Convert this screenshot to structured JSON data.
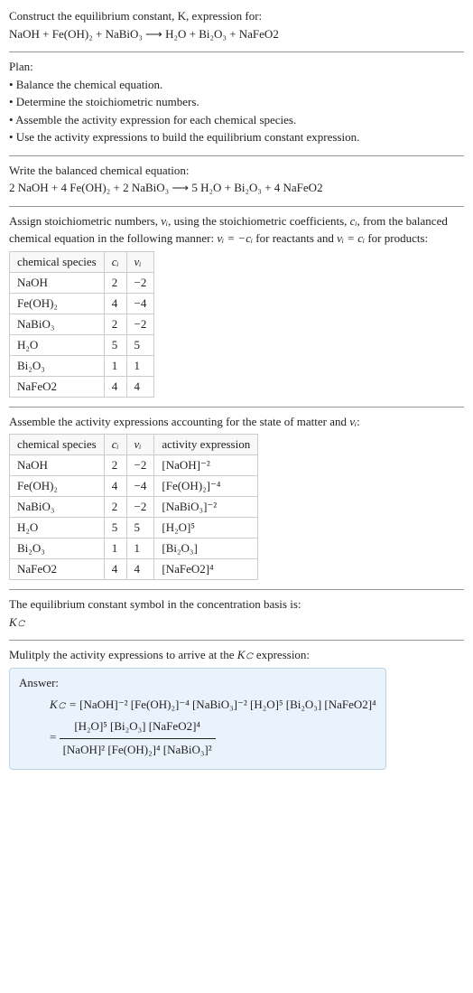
{
  "intro": {
    "title": "Construct the equilibrium constant, K, expression for:",
    "equation": "NaOH + Fe(OH)₂ + NaBiO₃ ⟶ H₂O + Bi₂O₃ + NaFeO2"
  },
  "plan": {
    "heading": "Plan:",
    "items": [
      "• Balance the chemical equation.",
      "• Determine the stoichiometric numbers.",
      "• Assemble the activity expression for each chemical species.",
      "• Use the activity expressions to build the equilibrium constant expression."
    ]
  },
  "balanced": {
    "heading": "Write the balanced chemical equation:",
    "equation": "2 NaOH + 4 Fe(OH)₂ + 2 NaBiO₃ ⟶ 5 H₂O + Bi₂O₃ + 4 NaFeO2"
  },
  "stoich": {
    "intro_a": "Assign stoichiometric numbers, ",
    "nu": "νᵢ",
    "intro_b": ", using the stoichiometric coefficients, ",
    "ci": "cᵢ",
    "intro_c": ", from the balanced chemical equation in the following manner: ",
    "rule_r": "νᵢ = −cᵢ",
    "intro_d": " for reactants and ",
    "rule_p": "νᵢ = cᵢ",
    "intro_e": " for products:",
    "headers": [
      "chemical species",
      "cᵢ",
      "νᵢ"
    ],
    "rows": [
      [
        "NaOH",
        "2",
        "−2"
      ],
      [
        "Fe(OH)₂",
        "4",
        "−4"
      ],
      [
        "NaBiO₃",
        "2",
        "−2"
      ],
      [
        "H₂O",
        "5",
        "5"
      ],
      [
        "Bi₂O₃",
        "1",
        "1"
      ],
      [
        "NaFeO2",
        "4",
        "4"
      ]
    ]
  },
  "activity": {
    "intro_a": "Assemble the activity expressions accounting for the state of matter and ",
    "nu": "νᵢ",
    "intro_b": ":",
    "headers": [
      "chemical species",
      "cᵢ",
      "νᵢ",
      "activity expression"
    ],
    "rows": [
      [
        "NaOH",
        "2",
        "−2",
        "[NaOH]⁻²"
      ],
      [
        "Fe(OH)₂",
        "4",
        "−4",
        "[Fe(OH)₂]⁻⁴"
      ],
      [
        "NaBiO₃",
        "2",
        "−2",
        "[NaBiO₃]⁻²"
      ],
      [
        "H₂O",
        "5",
        "5",
        "[H₂O]⁵"
      ],
      [
        "Bi₂O₃",
        "1",
        "1",
        "[Bi₂O₃]"
      ],
      [
        "NaFeO2",
        "4",
        "4",
        "[NaFeO2]⁴"
      ]
    ]
  },
  "kc_symbol": {
    "text": "The equilibrium constant symbol in the concentration basis is:",
    "symbol": "K𝚌"
  },
  "final": {
    "intro_a": "Mulitply the activity expressions to arrive at the ",
    "kc": "K𝚌",
    "intro_b": " expression:",
    "answer_label": "Answer:",
    "lhs": "K𝚌 = ",
    "flat": "[NaOH]⁻² [Fe(OH)₂]⁻⁴ [NaBiO₃]⁻² [H₂O]⁵ [Bi₂O₃] [NaFeO2]⁴",
    "eq": "  = ",
    "num": "[H₂O]⁵ [Bi₂O₃] [NaFeO2]⁴",
    "den": "[NaOH]² [Fe(OH)₂]⁴ [NaBiO₃]²"
  },
  "chart_data": {
    "type": "table",
    "tables": [
      {
        "title": "stoichiometric numbers",
        "headers": [
          "chemical species",
          "c_i",
          "nu_i"
        ],
        "rows": [
          [
            "NaOH",
            2,
            -2
          ],
          [
            "Fe(OH)2",
            4,
            -4
          ],
          [
            "NaBiO3",
            2,
            -2
          ],
          [
            "H2O",
            5,
            5
          ],
          [
            "Bi2O3",
            1,
            1
          ],
          [
            "NaFeO2",
            4,
            4
          ]
        ]
      },
      {
        "title": "activity expressions",
        "headers": [
          "chemical species",
          "c_i",
          "nu_i",
          "activity expression"
        ],
        "rows": [
          [
            "NaOH",
            2,
            -2,
            "[NaOH]^-2"
          ],
          [
            "Fe(OH)2",
            4,
            -4,
            "[Fe(OH)2]^-4"
          ],
          [
            "NaBiO3",
            2,
            -2,
            "[NaBiO3]^-2"
          ],
          [
            "H2O",
            5,
            5,
            "[H2O]^5"
          ],
          [
            "Bi2O3",
            1,
            1,
            "[Bi2O3]"
          ],
          [
            "NaFeO2",
            4,
            4,
            "[NaFeO2]^4"
          ]
        ]
      }
    ]
  }
}
